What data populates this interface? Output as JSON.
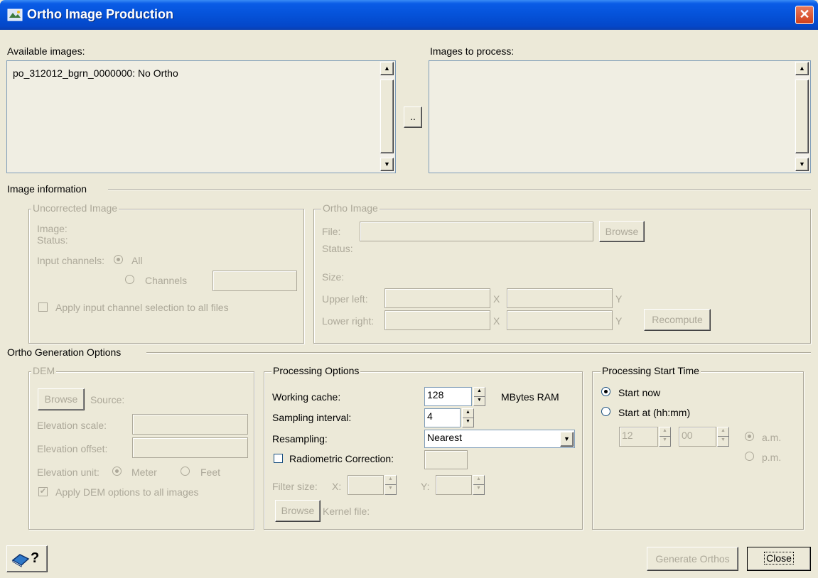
{
  "window": {
    "title": "Ortho Image Production",
    "close_glyph": "✕"
  },
  "available": {
    "label": "Available images:",
    "items": [
      "po_312012_bgrn_0000000: No Ortho"
    ]
  },
  "to_process": {
    "label": "Images to process:"
  },
  "move_button_label": "..",
  "image_info": {
    "label": "Image information",
    "uncorrected": {
      "legend": "Uncorrected Image",
      "image_label": "Image:",
      "status_label": "Status:",
      "input_channels_label": "Input channels:",
      "all_label": "All",
      "channels_label": "Channels",
      "apply_all_label": "Apply input channel selection to all files"
    },
    "ortho": {
      "legend": "Ortho Image",
      "file_label": "File:",
      "browse_label": "Browse",
      "status_label": "Status:",
      "size_label": "Size:",
      "upper_left_label": "Upper left:",
      "lower_right_label": "Lower right:",
      "x_label": "X",
      "y_label": "Y",
      "recompute_label": "Recompute"
    }
  },
  "ortho_gen": {
    "label": "Ortho Generation Options",
    "dem": {
      "legend": "DEM",
      "browse_label": "Browse",
      "source_label": "Source:",
      "elev_scale_label": "Elevation scale:",
      "elev_offset_label": "Elevation offset:",
      "elev_unit_label": "Elevation unit:",
      "meter_label": "Meter",
      "feet_label": "Feet",
      "apply_all_label": "Apply DEM options to all images"
    },
    "processing": {
      "legend": "Processing Options",
      "working_cache_label": "Working cache:",
      "working_cache_value": "128",
      "mbytes_label": "MBytes RAM",
      "sampling_label": "Sampling interval:",
      "sampling_value": "4",
      "resampling_label": "Resampling:",
      "resampling_value": "Nearest",
      "radiometric_label": "Radiometric Correction:",
      "filter_size_label": "Filter size:",
      "x_label": "X:",
      "y_label": "Y:",
      "browse_label": "Browse",
      "kernel_label": "Kernel file:"
    },
    "start_time": {
      "legend": "Processing Start Time",
      "start_now_label": "Start now",
      "start_at_label": "Start at (hh:mm)",
      "hour_value": "12",
      "minute_value": "00",
      "am_label": "a.m.",
      "pm_label": "p.m."
    }
  },
  "footer": {
    "help_label": "?",
    "generate_label": "Generate Orthos",
    "close_label": "Close"
  },
  "colors": {
    "title_bar": "#0552d9",
    "dialog_bg": "#ece9d8",
    "disabled_text": "#aca899",
    "close_button": "#d1401c"
  }
}
